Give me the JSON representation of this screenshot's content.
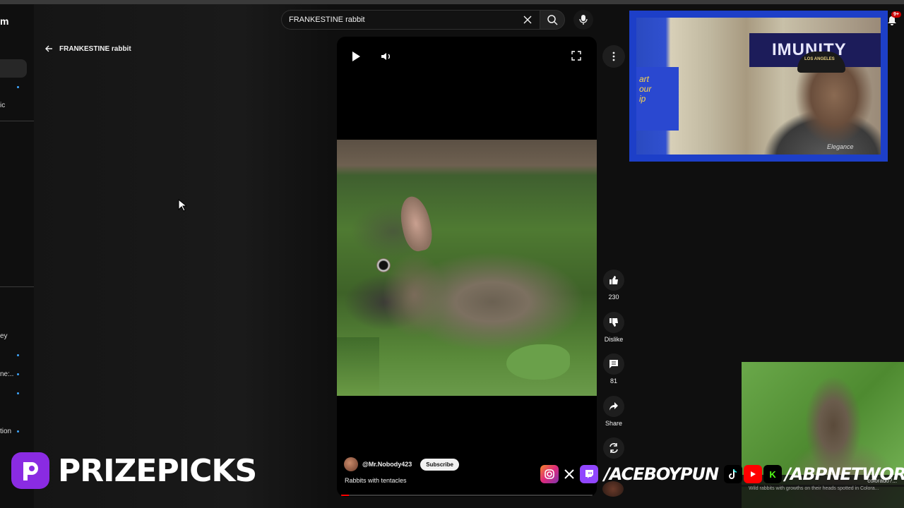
{
  "sidebar": {
    "logo_text": "m",
    "items": [
      {
        "label": "ic"
      },
      {
        "label": "ey"
      },
      {
        "label": "ne:.."
      },
      {
        "label": "tion"
      }
    ]
  },
  "search": {
    "query": "FRANKESTINE rabbit"
  },
  "back": {
    "label": "FRANKESTINE rabbit"
  },
  "video": {
    "channel": "@Mr.Nobody423",
    "subscribe_label": "Subscribe",
    "title": "Rabbits with tentacles",
    "progress": 0.03
  },
  "actions": {
    "like_count": "230",
    "dislike_label": "Dislike",
    "comment_count": "81",
    "share_label": "Share"
  },
  "notifications": {
    "badge": "9+"
  },
  "webcam": {
    "sign_text": "IMUNITY",
    "poster_text": "art\nour\nip",
    "cap_text": "LOS ANGELES",
    "shirt_text": "Elegance"
  },
  "suggested": {
    "title": "colorado?...",
    "description": "Wild rabbits with growths on their heads spotted in Colora..."
  },
  "overlay": {
    "brand": "PRIZEPICKS",
    "handle_1": "/ACEBOYPUN",
    "handle_2": "/ABPNETWORK",
    "kick_letter": "K"
  },
  "colors": {
    "accent_red": "#ff0000",
    "webcam_border": "#1d3fc8",
    "brand_purple": "#8a2be2"
  }
}
